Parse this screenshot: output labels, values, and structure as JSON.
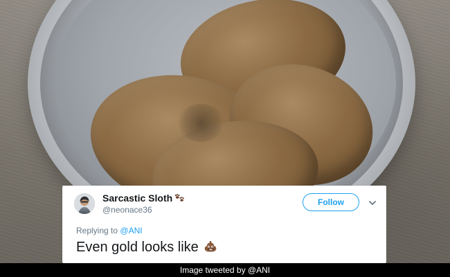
{
  "tweet": {
    "display_name": "Sarcastic Sloth",
    "handle": "@neonace36",
    "follow_label": "Follow",
    "replying_prefix": "Replying to",
    "replying_to": "@ANI",
    "text": "Even gold looks like"
  },
  "caption": {
    "text": "Image tweeted by @ANI"
  },
  "icons": {
    "name_badge": "paw-prints-icon",
    "tweet_emoji": "pile-of-poo-icon",
    "menu": "chevron-down-icon"
  },
  "colors": {
    "twitter_blue": "#1da1f2",
    "text_primary": "#14171a",
    "text_secondary": "#657786",
    "caption_bg": "#000000"
  }
}
